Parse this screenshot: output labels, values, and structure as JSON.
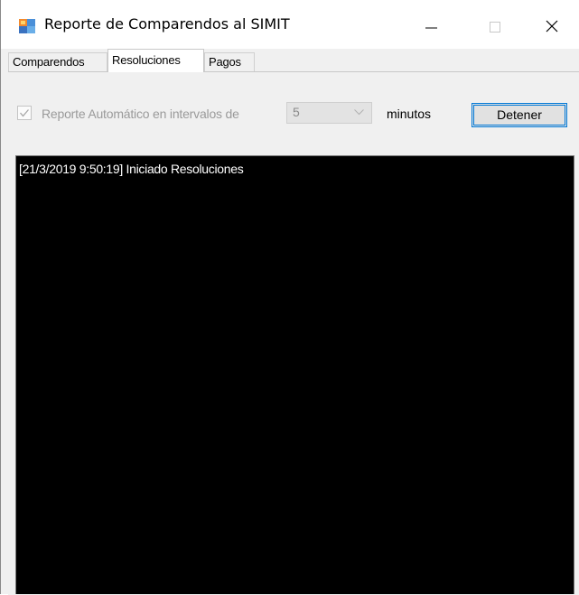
{
  "window": {
    "title": "Reporte de Comparendos al SIMIT",
    "controls": {
      "minimize": "minimize-icon",
      "maximize": "maximize-icon",
      "close": "close-icon"
    }
  },
  "tabs": [
    {
      "label": "Comparendos",
      "selected": false
    },
    {
      "label": "Resoluciones",
      "selected": true
    },
    {
      "label": "Pagos",
      "selected": false
    }
  ],
  "toolbar": {
    "auto_report_label": "Reporte Automático  en intervalos de",
    "auto_report_checked": true,
    "auto_report_enabled": false,
    "interval_value": "5",
    "interval_unit_label": "minutos",
    "stop_button_label": "Detener"
  },
  "log": {
    "lines": [
      "[21/3/2019 9:50:19] Iniciado Resoluciones"
    ]
  },
  "colors": {
    "log_background": "#000000",
    "log_text": "#ffffff",
    "button_focus_border": "#0078d7"
  }
}
